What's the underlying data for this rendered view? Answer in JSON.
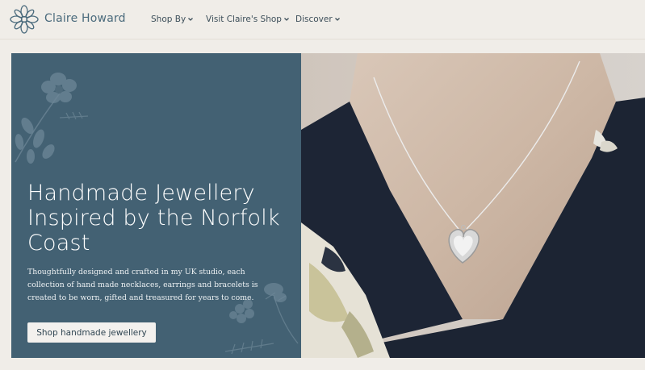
{
  "header": {
    "brand": "Claire Howard",
    "logo_icon": "flower-logo-icon",
    "nav": [
      {
        "label": "Shop By",
        "icon": "chevron-down-icon"
      },
      {
        "label": "Visit Claire's Shop",
        "icon": "chevron-down-icon"
      },
      {
        "label": "Discover",
        "icon": "chevron-down-icon"
      }
    ]
  },
  "hero": {
    "headline": "Handmade Jewellery Inspired by the Norfolk Coast",
    "body": "Thoughtfully designed and crafted in my UK studio, each collection of hand made necklaces, earrings and bracelets is created to be worn, gifted and treasured for years to come.",
    "cta_label": "Shop handmade jewellery",
    "image_subject": "heart-pendant-necklace-photo"
  },
  "colors": {
    "page_bg": "#f0ede8",
    "hero_panel": "#436173",
    "brand_text": "#4a6a7c",
    "button_bg": "#f3f1ee"
  }
}
